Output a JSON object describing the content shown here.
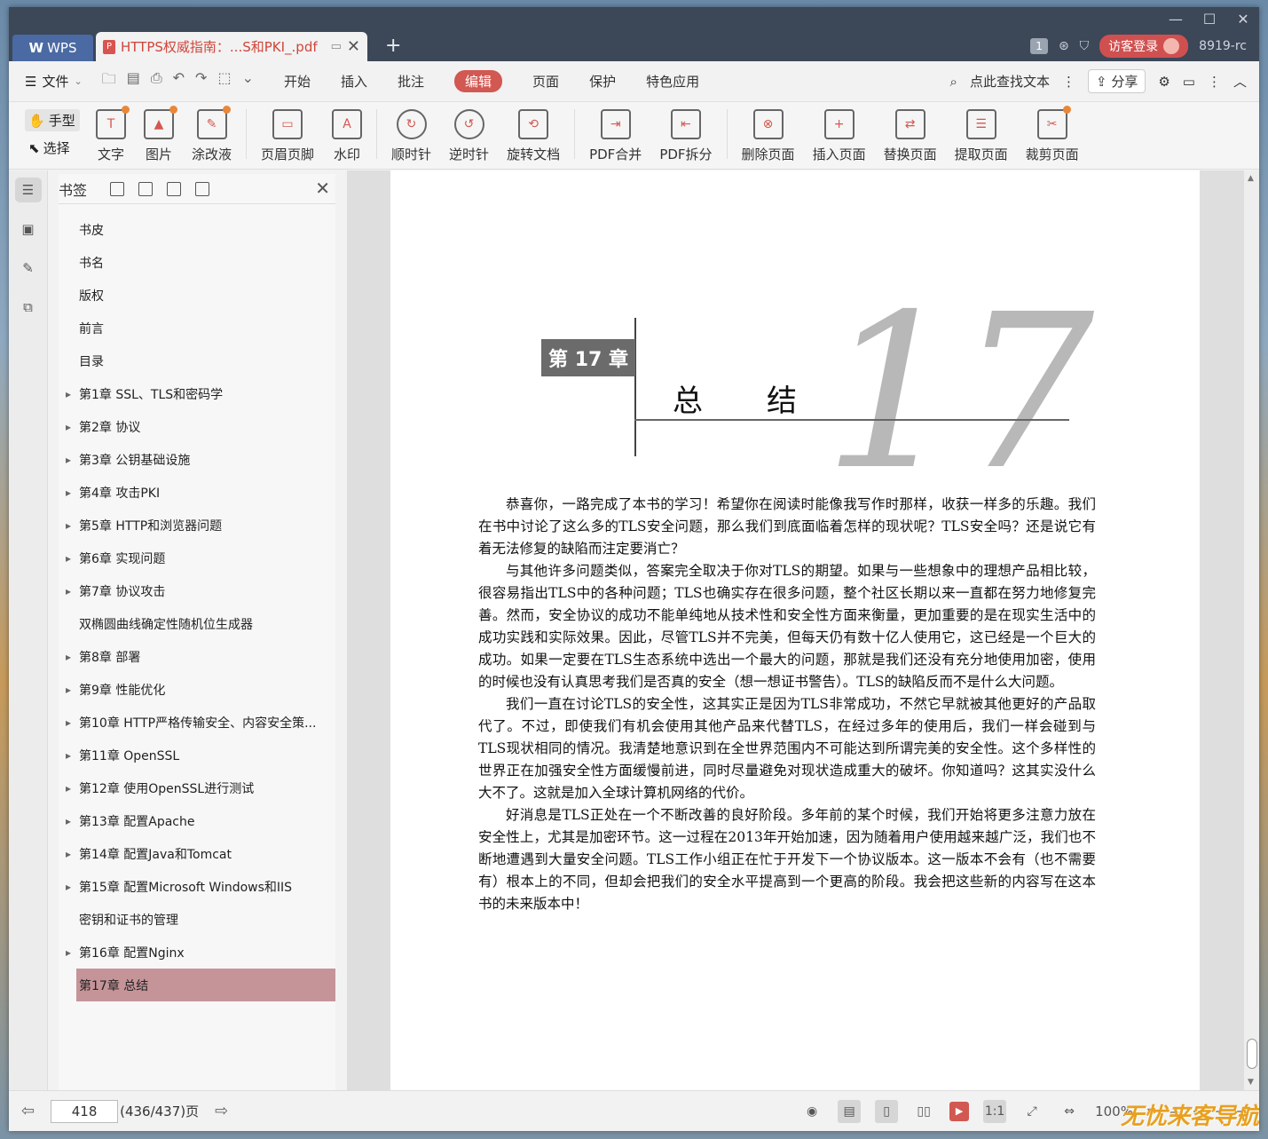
{
  "titlebar": {
    "app_label": "WPS",
    "doc_tab_title": "HTTPS权威指南：...S和PKI_.pdf",
    "new_tab": "+",
    "badge": "1",
    "login": "访客登录",
    "user": "8919-rc"
  },
  "menu": {
    "file": "文件",
    "items": [
      "开始",
      "插入",
      "批注"
    ],
    "active": "编辑",
    "items2": [
      "页面",
      "保护",
      "特色应用"
    ],
    "search": "点此查找文本",
    "share": "分享"
  },
  "toolbar": {
    "hand": "手型",
    "select": "选择",
    "tools": [
      "文字",
      "图片",
      "涂改液",
      "页眉页脚",
      "水印",
      "顺时针",
      "逆时针",
      "旋转文档",
      "PDF合并",
      "PDF拆分",
      "删除页面",
      "插入页面",
      "替换页面",
      "提取页面",
      "裁剪页面"
    ]
  },
  "bookmarks": {
    "title": "书签",
    "items": [
      {
        "label": "书皮",
        "toggle": false
      },
      {
        "label": "书名",
        "toggle": false
      },
      {
        "label": "版权",
        "toggle": false
      },
      {
        "label": "前言",
        "toggle": false
      },
      {
        "label": "目录",
        "toggle": false
      },
      {
        "label": "第1章 SSL、TLS和密码学",
        "toggle": true
      },
      {
        "label": "第2章 协议",
        "toggle": true
      },
      {
        "label": "第3章 公钥基础设施",
        "toggle": true
      },
      {
        "label": "第4章 攻击PKI",
        "toggle": true
      },
      {
        "label": "第5章 HTTP和浏览器问题",
        "toggle": true
      },
      {
        "label": "第6章 实现问题",
        "toggle": true
      },
      {
        "label": "第7章 协议攻击",
        "toggle": true
      },
      {
        "label": "双椭圆曲线确定性随机位生成器",
        "toggle": false
      },
      {
        "label": "第8章 部署",
        "toggle": true
      },
      {
        "label": "第9章 性能优化",
        "toggle": true
      },
      {
        "label": "第10章 HTTP严格传输安全、内容安全策...",
        "toggle": true
      },
      {
        "label": "第11章 OpenSSL",
        "toggle": true
      },
      {
        "label": "第12章 使用OpenSSL进行测试",
        "toggle": true
      },
      {
        "label": "第13章 配置Apache",
        "toggle": true
      },
      {
        "label": "第14章 配置Java和Tomcat",
        "toggle": true
      },
      {
        "label": "第15章 配置Microsoft Windows和IIS",
        "toggle": true
      },
      {
        "label": "密钥和证书的管理",
        "toggle": false
      },
      {
        "label": "第16章 配置Nginx",
        "toggle": true
      },
      {
        "label": "第17章 总结",
        "toggle": false,
        "active": true
      }
    ]
  },
  "page": {
    "chapter_label": "第 17 章",
    "chapter_title": "总结",
    "big_number": "17",
    "paragraphs": [
      "恭喜你，一路完成了本书的学习！希望你在阅读时能像我写作时那样，收获一样多的乐趣。我们在书中讨论了这么多的TLS安全问题，那么我们到底面临着怎样的现状呢？TLS安全吗？还是说它有着无法修复的缺陷而注定要消亡？",
      "与其他许多问题类似，答案完全取决于你对TLS的期望。如果与一些想象中的理想产品相比较，很容易指出TLS中的各种问题；TLS也确实存在很多问题，整个社区长期以来一直都在努力地修复完善。然而，安全协议的成功不能单纯地从技术性和安全性方面来衡量，更加重要的是在现实生活中的成功实践和实际效果。因此，尽管TLS并不完美，但每天仍有数十亿人使用它，这已经是一个巨大的成功。如果一定要在TLS生态系统中选出一个最大的问题，那就是我们还没有充分地使用加密，使用的时候也没有认真思考我们是否真的安全（想一想证书警告）。TLS的缺陷反而不是什么大问题。",
      "我们一直在讨论TLS的安全性，这其实正是因为TLS非常成功，不然它早就被其他更好的产品取代了。不过，即使我们有机会使用其他产品来代替TLS，在经过多年的使用后，我们一样会碰到与TLS现状相同的情况。我清楚地意识到在全世界范围内不可能达到所谓完美的安全性。这个多样性的世界正在加强安全性方面缓慢前进，同时尽量避免对现状造成重大的破坏。你知道吗？这其实没什么大不了。这就是加入全球计算机网络的代价。",
      "好消息是TLS正处在一个不断改善的良好阶段。多年前的某个时候，我们开始将更多注意力放在安全性上，尤其是加密环节。这一过程在2013年开始加速，因为随着用户使用越来越广泛，我们也不断地遭遇到大量安全问题。TLS工作小组正在忙于开发下一个协议版本。这一版本不会有（也不需要有）根本上的不同，但却会把我们的安全水平提高到一个更高的阶段。我会把这些新的内容写在这本书的未来版本中！"
    ]
  },
  "status": {
    "page_input": "418",
    "page_total": "(436/437)页",
    "zoom": "100%",
    "watermark": "无忧来客导航"
  }
}
